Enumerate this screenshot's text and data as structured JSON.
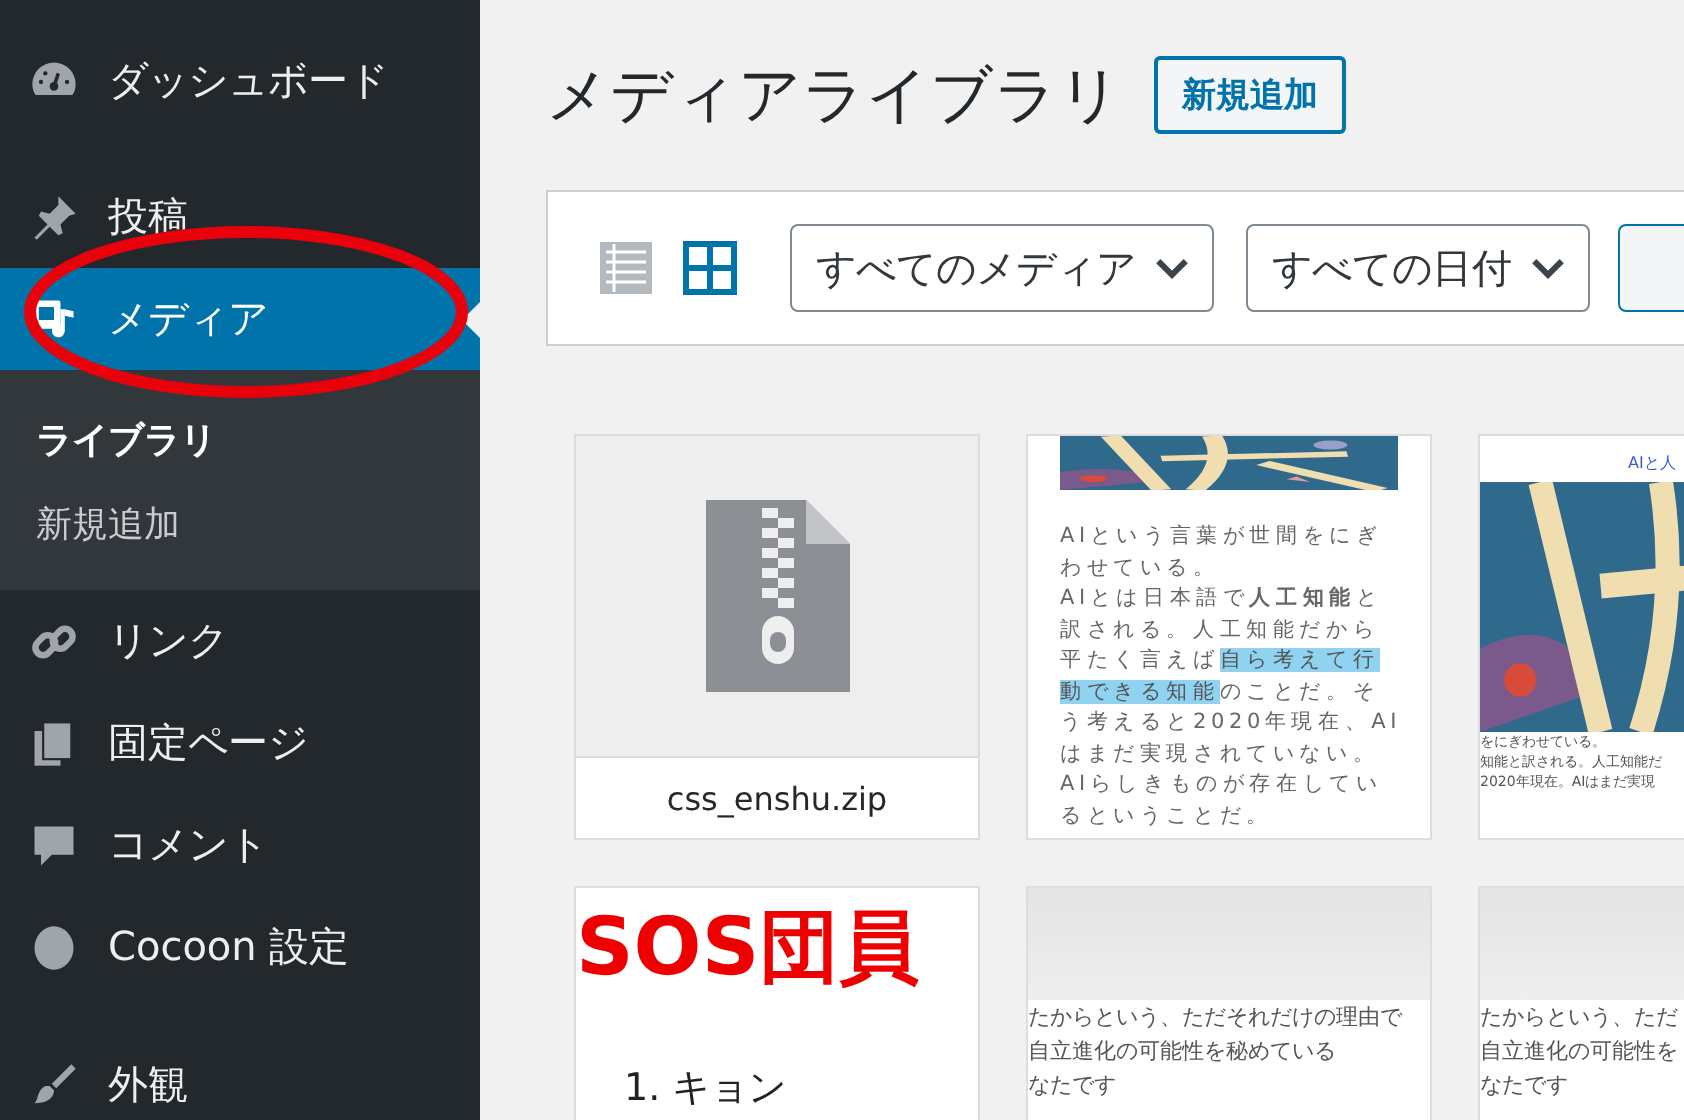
{
  "sidebar": {
    "items": [
      {
        "label": "ダッシュボード",
        "selected": false
      },
      {
        "label": "投稿",
        "selected": false
      },
      {
        "label": "メディア",
        "selected": true,
        "children": [
          {
            "label": "ライブラリ",
            "selected": true
          },
          {
            "label": "新規追加",
            "selected": false
          }
        ]
      },
      {
        "label": "リンク",
        "selected": false
      },
      {
        "label": "固定ページ",
        "selected": false
      },
      {
        "label": "コメント",
        "selected": false
      },
      {
        "label": "Cocoon 設定",
        "selected": false
      },
      {
        "label": "外観",
        "selected": false
      }
    ]
  },
  "header": {
    "title": "メディアライブラリ",
    "add_button": "新規追加"
  },
  "toolbar": {
    "views": [
      {
        "kind": "list",
        "selected": false
      },
      {
        "kind": "grid",
        "selected": true
      }
    ],
    "filters": [
      "すべてのメディア",
      "すべての日付"
    ]
  },
  "media": [
    {
      "kind": "file",
      "filename": "css_enshu.zip"
    },
    {
      "kind": "article",
      "segments": [
        {
          "text": "AIという言葉が世間をにぎわせている。",
          "highlight": false
        },
        {
          "text": "AIとは日本語で**人工知能**と訳される。人工知能だから平たく言えば",
          "highlight": false
        },
        {
          "text": "自ら考えて行動できる知能",
          "highlight": true
        },
        {
          "text": "のことだ。そう考えると2020年現在、AIはまだ実現されていない。AIらしきものが存在しているということだ。",
          "highlight": false
        }
      ]
    },
    {
      "kind": "article",
      "heading": "AIと人",
      "lines": [
        "をにぎわせている。",
        "知能と訳される。人工知能だ",
        "2020年現在。AIはまだ実現"
      ]
    },
    {
      "kind": "list",
      "heading": "SOS団員",
      "list": [
        "1. キョン"
      ]
    },
    {
      "kind": "excerpt",
      "lines": [
        "たからという、ただそれだけの理由で",
        "自立進化の可能性を秘めている",
        "なたです"
      ]
    },
    {
      "kind": "excerpt",
      "lines": [
        "たからという、ただ",
        "自立進化の可能性を",
        "なたです"
      ]
    }
  ]
}
